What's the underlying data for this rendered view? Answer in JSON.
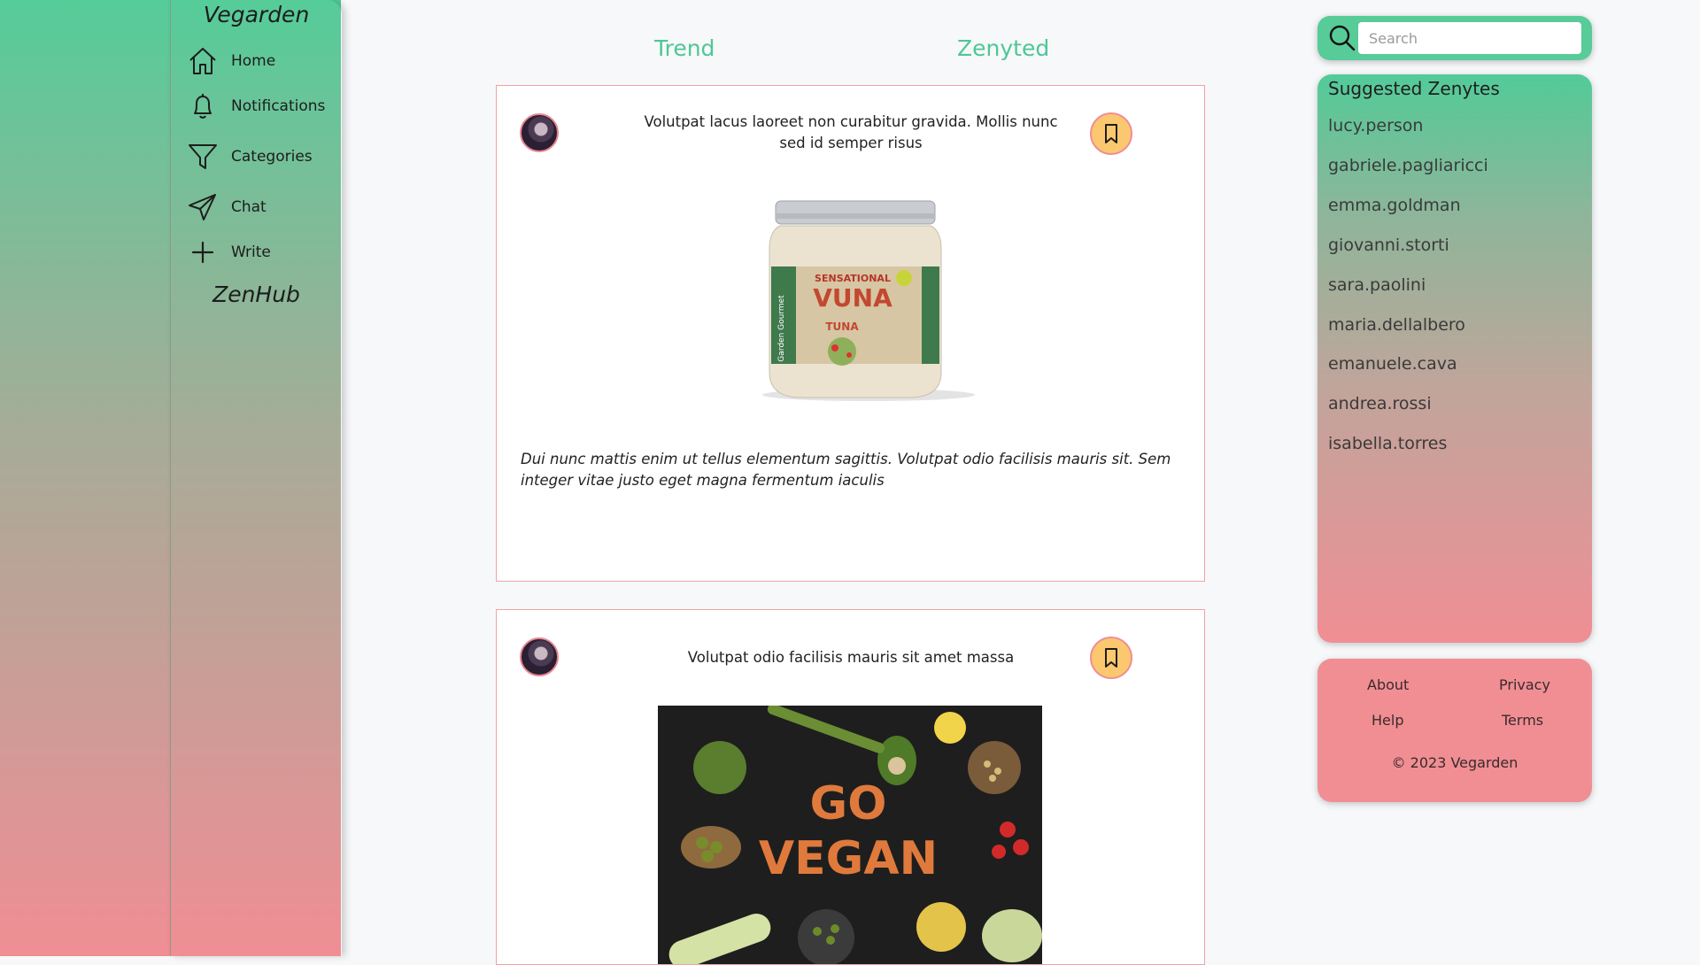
{
  "app": {
    "brand": "Vegarden",
    "section_label": "ZenHub"
  },
  "sidebar": {
    "items": [
      {
        "label": "Home",
        "icon": "home-icon"
      },
      {
        "label": "Notifications",
        "icon": "bell-icon"
      },
      {
        "label": "Categories",
        "icon": "filter-icon"
      },
      {
        "label": "Chat",
        "icon": "send-icon"
      },
      {
        "label": "Write",
        "icon": "plus-icon"
      }
    ]
  },
  "tabs": [
    {
      "label": "Trend"
    },
    {
      "label": "Zenyted"
    }
  ],
  "posts": [
    {
      "title": "Volutpat lacus laoreet non curabitur gravida. Mollis nunc sed id semper risus",
      "body": "Dui nunc mattis enim ut tellus elementum sagittis. Volutpat odio facilisis mauris sit. Sem integer vitae justo eget magna fermentum iaculis",
      "image": {
        "label_line1": "SENSATIONAL",
        "label_line2": "VUNA",
        "label_line3": "TUNA",
        "brand": "Garden Gourmet"
      }
    },
    {
      "title": "Volutpat odio facilisis mauris sit amet massa",
      "image": {
        "text_line1": "GO",
        "text_line2": "VEGAN"
      }
    }
  ],
  "search": {
    "placeholder": "Search"
  },
  "suggestions": {
    "title": "Suggested Zenytes",
    "users": [
      "lucy.person",
      "gabriele.pagliaricci",
      "emma.goldman",
      "giovanni.storti",
      "sara.paolini",
      "maria.dellalbero",
      "emanuele.cava",
      "andrea.rossi",
      "isabella.torres"
    ]
  },
  "footer": {
    "about": "About",
    "privacy": "Privacy",
    "help": "Help",
    "terms": "Terms",
    "copyright": "© 2023 Vegarden"
  },
  "colors": {
    "accent_green": "#55cc99",
    "accent_pink": "#f08e94",
    "bookmark_yellow": "#fcc86f"
  }
}
